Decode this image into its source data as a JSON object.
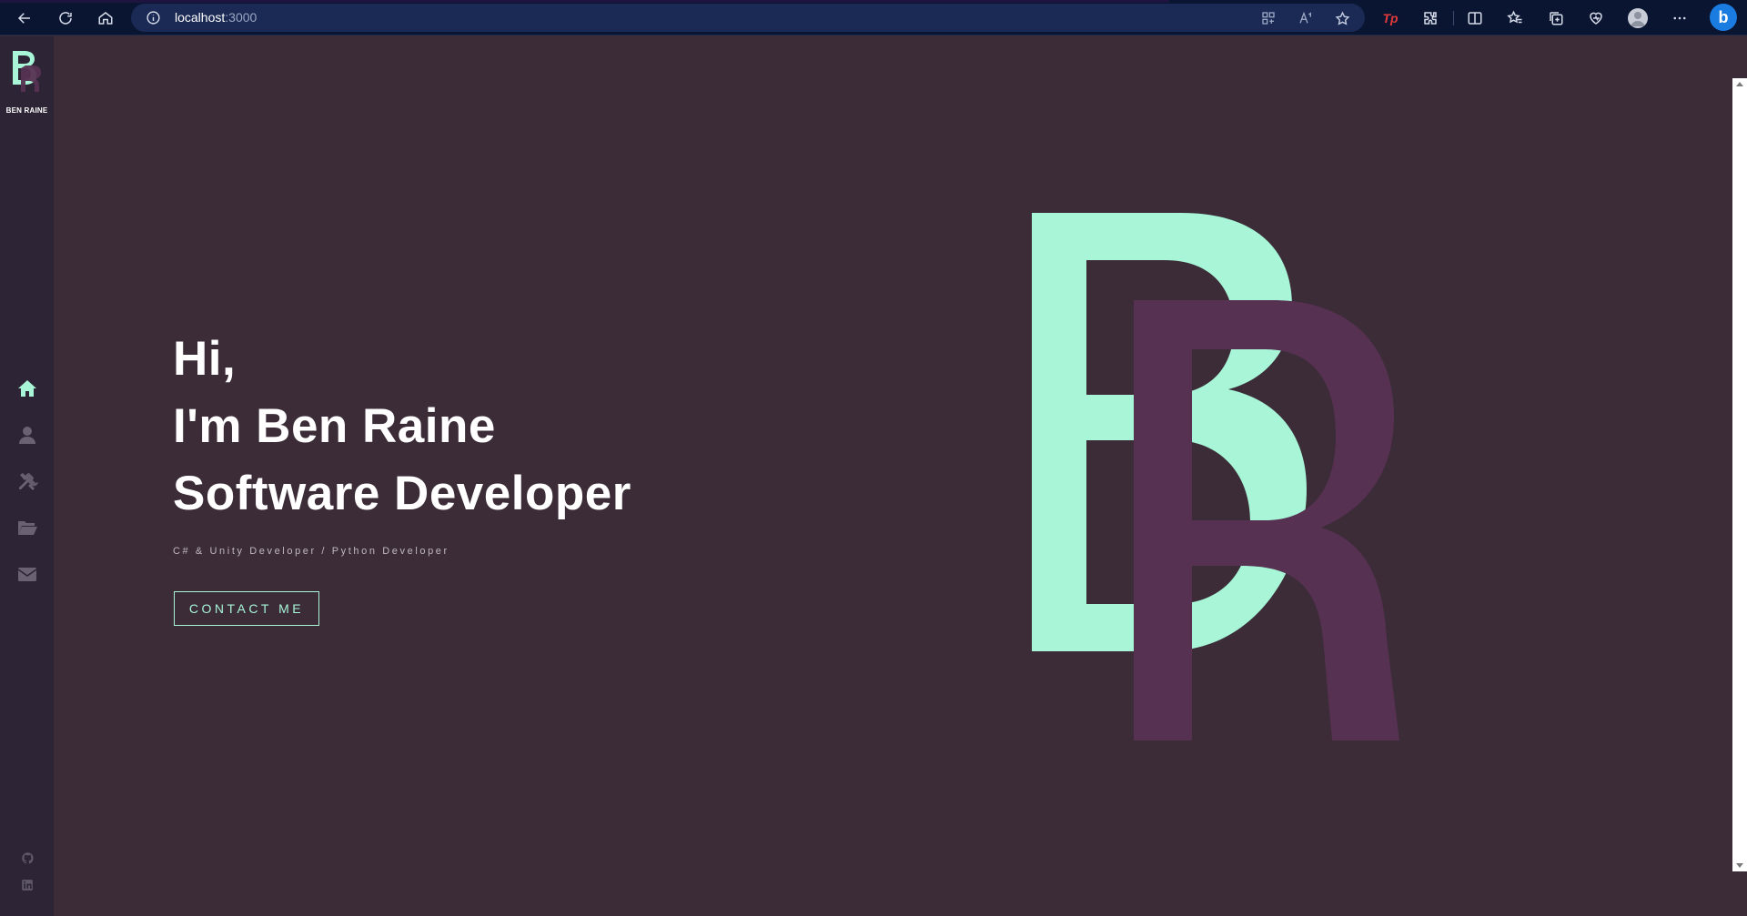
{
  "browser": {
    "url_host": "localhost",
    "url_port": ":3000",
    "icons": [
      "back-icon",
      "refresh-icon",
      "home-icon",
      "site-info-icon",
      "app-available-icon",
      "read-aloud-icon",
      "favorite-star-icon",
      "tp-extension-icon",
      "extensions-icon",
      "split-screen-icon",
      "favorites-icon",
      "collections-icon",
      "browser-essentials-icon",
      "profile-avatar-icon",
      "more-icon",
      "bing-icon"
    ],
    "tp_label": "Tp",
    "bing_label": "b"
  },
  "sidebar": {
    "logo_text": "BEN RAINE",
    "nav": [
      {
        "name": "home",
        "icon": "home-icon",
        "active": true
      },
      {
        "name": "about",
        "icon": "user-icon",
        "active": false
      },
      {
        "name": "skills",
        "icon": "tools-icon",
        "active": false
      },
      {
        "name": "portfolio",
        "icon": "folder-open-icon",
        "active": false
      },
      {
        "name": "contact",
        "icon": "envelope-icon",
        "active": false
      }
    ],
    "social": [
      {
        "name": "github",
        "icon": "github-icon"
      },
      {
        "name": "linkedin",
        "icon": "linkedin-icon"
      }
    ]
  },
  "hero": {
    "line1": "Hi,",
    "line2": "I'm Ben Raine",
    "line3": "Software Developer",
    "subtitle": "C# & Unity Developer / Python Developer",
    "cta_label": "CONTACT ME"
  },
  "colors": {
    "background": "#3b2c37",
    "sidebar": "#2d2536",
    "accent": "#a8f5d8",
    "accent_purple": "#563152",
    "text": "#ffffff",
    "muted": "#6a6272"
  }
}
